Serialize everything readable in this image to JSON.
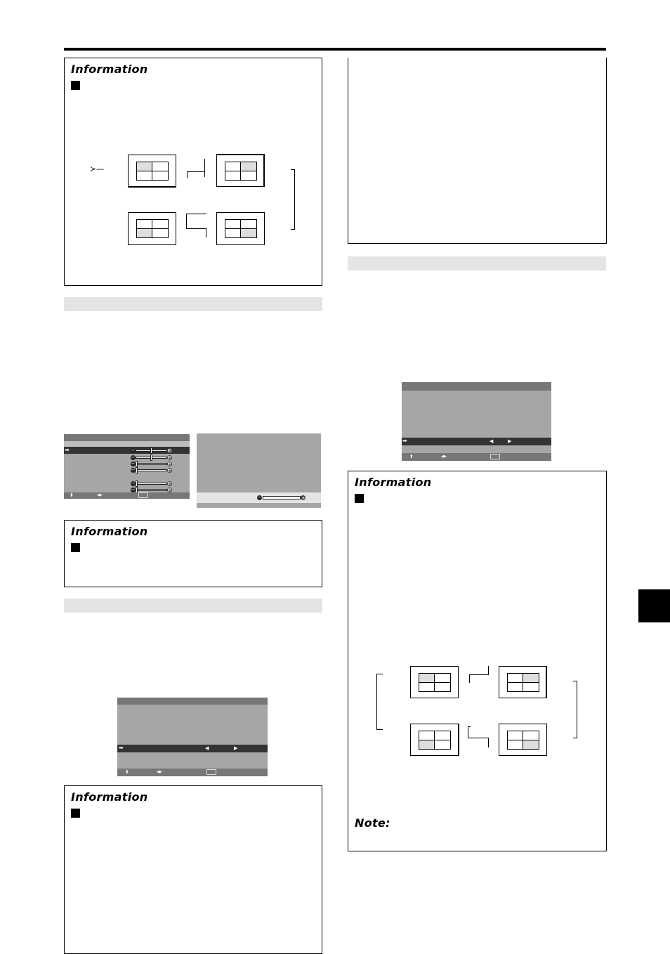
{
  "page": {
    "side_tab_label": ""
  },
  "info_boxes": [
    {
      "id": "info-top-left",
      "title": "Information"
    },
    {
      "id": "info-mid-left",
      "title": "Information"
    },
    {
      "id": "info-bottom-left",
      "title": "Information"
    },
    {
      "id": "info-right",
      "title": "Information",
      "note_title": "Note:"
    }
  ],
  "diagrams": {
    "top_left": {
      "start_marker": "Y-",
      "screens": [
        {
          "position": "top-left",
          "highlight": "top-left"
        },
        {
          "position": "top-right",
          "highlight": "top-right"
        },
        {
          "position": "bottom-left",
          "highlight": "bottom-left"
        },
        {
          "position": "bottom-right",
          "highlight": "bottom-right"
        }
      ]
    },
    "right": {
      "screens": [
        {
          "position": "top-left",
          "highlight": "top-left"
        },
        {
          "position": "top-right",
          "highlight": "top-right"
        },
        {
          "position": "bottom-left",
          "highlight": "bottom-left"
        },
        {
          "position": "bottom-right",
          "highlight": "bottom-right"
        }
      ]
    }
  },
  "osd_menus": {
    "picture_adjust": {
      "selected_row_icon": "arrow-right-icon",
      "sliders": [
        {
          "row": 1,
          "value": 0.5,
          "selected": true
        },
        {
          "row": 2,
          "value": 0.5,
          "selected": false
        },
        {
          "row": 3,
          "value": 0.0,
          "selected": false
        },
        {
          "row": 4,
          "value": 0.0,
          "selected": false
        },
        {
          "row": 6,
          "value": 0.0,
          "selected": false
        },
        {
          "row": 7,
          "value": 0.0,
          "selected": false
        }
      ],
      "footer_icons": [
        "up-down-icon",
        "left-right-icon",
        "exit-button-icon"
      ]
    },
    "picture_preview": {
      "slider_value": 1.0
    },
    "menu_left_bottom": {
      "selected_row_icon": "arrow-right-icon",
      "value_arrows": [
        "arrow-left-icon",
        "arrow-right-icon"
      ],
      "footer_icons": [
        "up-down-icon",
        "left-right-icon",
        "exit-button-icon"
      ]
    },
    "menu_right": {
      "selected_row_icon": "arrow-right-icon",
      "value_arrows": [
        "arrow-left-icon",
        "arrow-right-icon"
      ],
      "footer_icons": [
        "up-down-icon",
        "left-right-icon",
        "exit-button-icon"
      ]
    }
  },
  "icons": {
    "arrow_right": "➡",
    "arrow_left_small": "◀",
    "arrow_right_small": "▶",
    "up_down": "⬍",
    "left_right": "◀▶",
    "minus": "−",
    "plus": "+"
  }
}
